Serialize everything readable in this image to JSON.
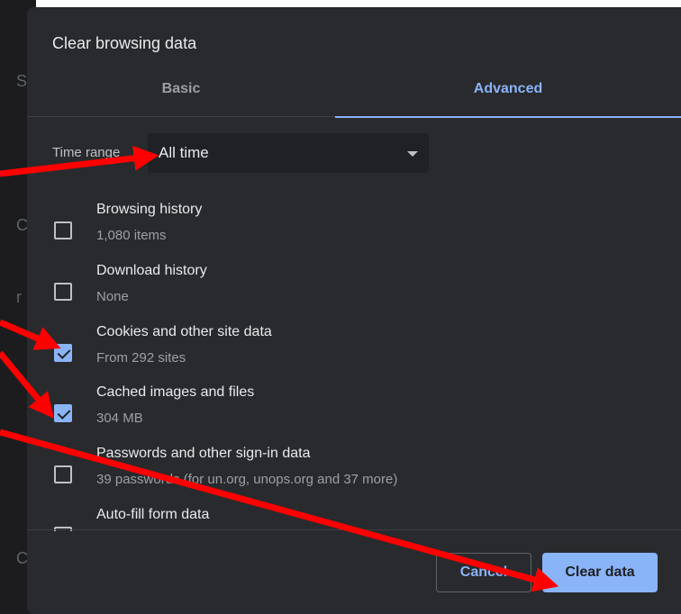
{
  "dialog": {
    "title": "Clear browsing data"
  },
  "tabs": [
    {
      "label": "Basic",
      "selected": false
    },
    {
      "label": "Advanced",
      "selected": true
    }
  ],
  "time_range": {
    "label": "Time range",
    "value": "All time"
  },
  "options": [
    {
      "label": "Browsing history",
      "detail": "1,080 items",
      "checked": false
    },
    {
      "label": "Download history",
      "detail": "None",
      "checked": false
    },
    {
      "label": "Cookies and other site data",
      "detail": "From 292 sites",
      "checked": true
    },
    {
      "label": "Cached images and files",
      "detail": "304 MB",
      "checked": true
    },
    {
      "label": "Passwords and other sign-in data",
      "detail": "39 passwords (for un.org, unops.org and 37 more)",
      "checked": false
    },
    {
      "label": "Auto-fill form data",
      "detail": "",
      "checked": false
    }
  ],
  "buttons": {
    "cancel": "Cancel",
    "clear": "Clear data"
  },
  "colors": {
    "dialog_bg": "#292a2d",
    "accent": "#8ab4f8",
    "annotation_arrow": "#ff0000"
  }
}
